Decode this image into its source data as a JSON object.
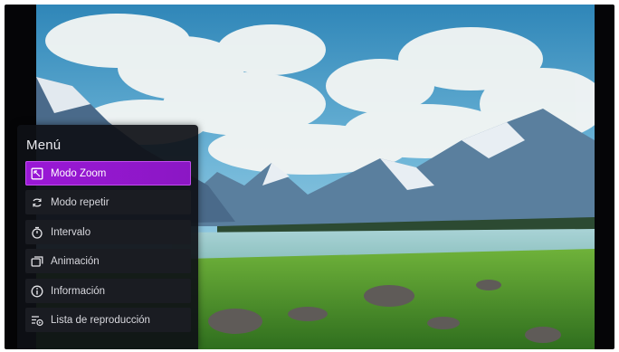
{
  "menu": {
    "title": "Menú",
    "items": [
      {
        "label": "Modo Zoom",
        "icon": "zoom-mode-icon",
        "selected": true
      },
      {
        "label": "Modo repetir",
        "icon": "repeat-icon",
        "selected": false
      },
      {
        "label": "Intervalo",
        "icon": "timer-icon",
        "selected": false
      },
      {
        "label": "Animación",
        "icon": "animation-icon",
        "selected": false
      },
      {
        "label": "Información",
        "icon": "info-icon",
        "selected": false
      },
      {
        "label": "Lista de reproducción",
        "icon": "playlist-icon",
        "selected": false
      }
    ]
  },
  "colors": {
    "accent": "#9a18d6",
    "menu_background": "#0e1016",
    "item_background": "#1a1c22"
  }
}
